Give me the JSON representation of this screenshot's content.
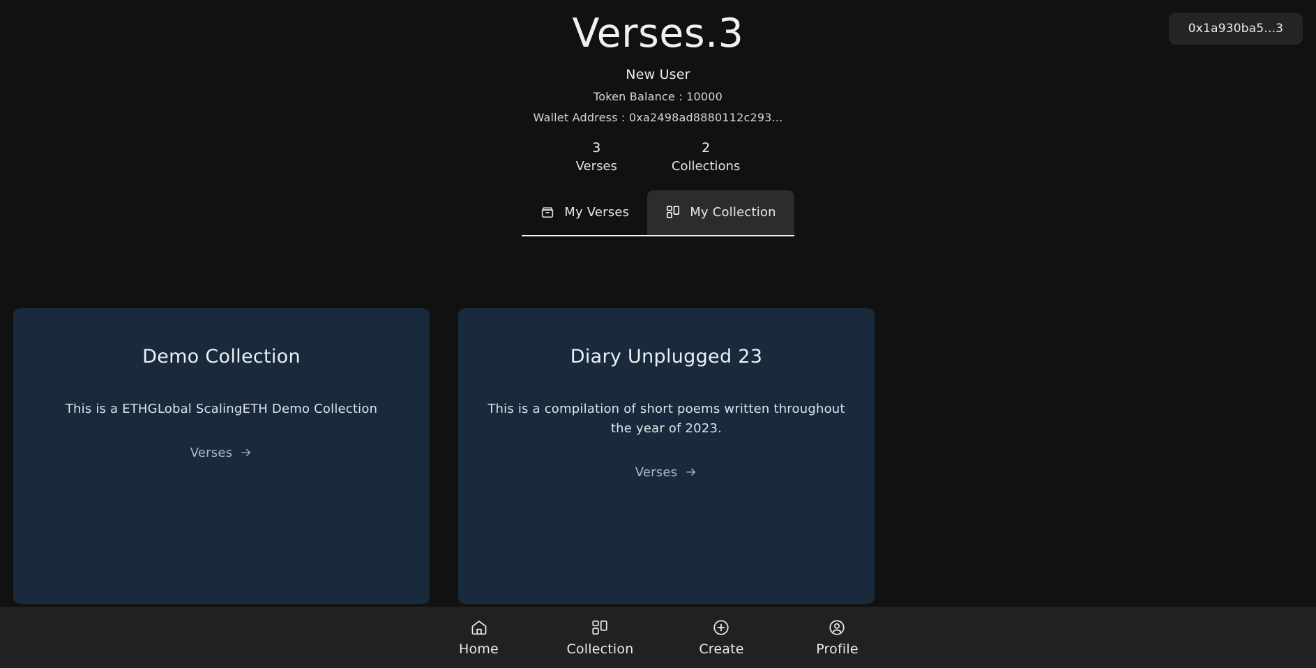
{
  "app": {
    "title": "Verses.3",
    "background": "#111112"
  },
  "wallet_chip": {
    "address_short": "0x1a930ba5...3"
  },
  "profile": {
    "name": "New User",
    "token_balance_line": "Token Balance : 10000",
    "wallet_address_line": "Wallet Address : 0xa2498ad8880112c293...",
    "stats": [
      {
        "value": "3",
        "label": "Verses",
        "name": "stat-verses"
      },
      {
        "value": "2",
        "label": "Collections",
        "name": "stat-collections"
      }
    ]
  },
  "tabs": [
    {
      "label": "My Verses",
      "icon": "archive-box-icon",
      "active": false
    },
    {
      "label": "My Collection",
      "icon": "layout-grid-icon",
      "active": true
    }
  ],
  "collections": [
    {
      "title": "Demo Collection",
      "description": "This is a ETHGLobal ScalingETH Demo Collection",
      "link_label": "Verses",
      "link_icon": "arrow-right-icon",
      "card_color": "#182a3c"
    },
    {
      "title": "Diary Unplugged 23",
      "description": "This is a compilation of short poems written throughout the year of 2023.",
      "link_label": "Verses",
      "link_icon": "arrow-right-icon",
      "card_color": "#182a3c"
    }
  ],
  "bottom_nav": [
    {
      "label": "Home",
      "icon": "home-icon"
    },
    {
      "label": "Collection",
      "icon": "layout-grid-icon"
    },
    {
      "label": "Create",
      "icon": "plus-circle-icon"
    },
    {
      "label": "Profile",
      "icon": "user-circle-icon"
    }
  ]
}
